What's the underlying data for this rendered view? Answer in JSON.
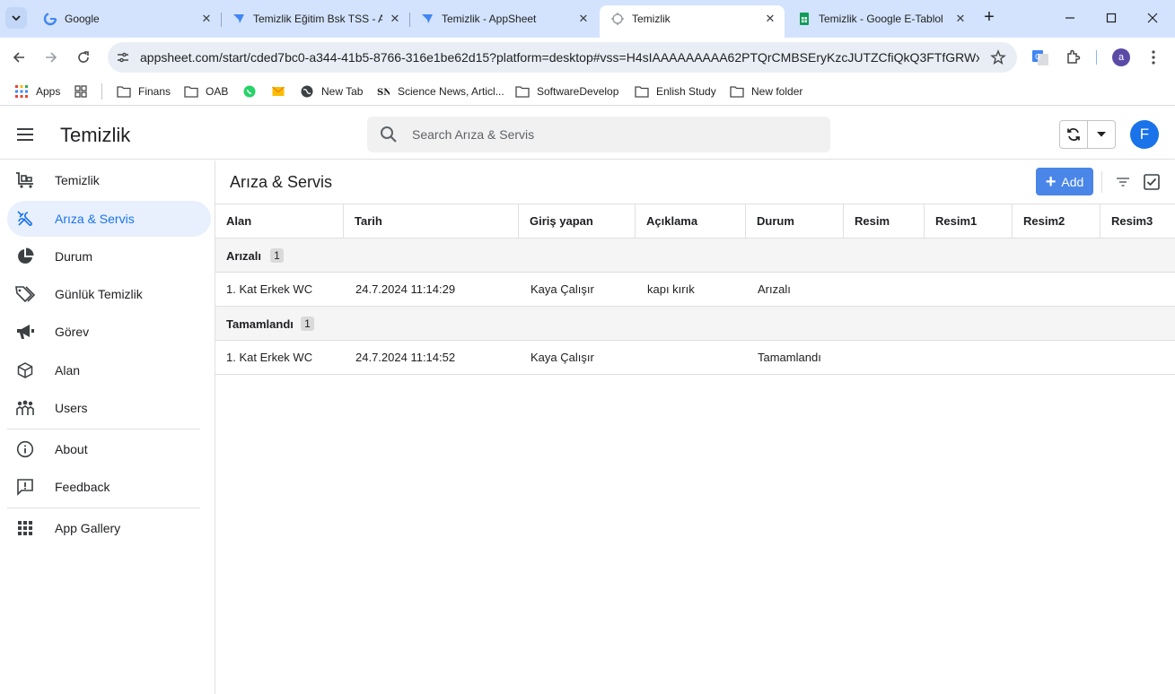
{
  "browser": {
    "tabs": [
      {
        "title": "Google",
        "favicon": "google-icon",
        "active": false
      },
      {
        "title": "Temizlik Eğitim Bsk TSS - A",
        "favicon": "appsheet-icon",
        "active": false
      },
      {
        "title": "Temizlik - AppSheet",
        "favicon": "appsheet-icon",
        "active": false
      },
      {
        "title": "Temizlik",
        "favicon": "loading-icon",
        "active": true
      },
      {
        "title": "Temizlik - Google E-Tablol",
        "favicon": "sheets-icon",
        "active": false
      }
    ],
    "url": "appsheet.com/start/cded7bc0-a344-41b5-8766-316e1be62d15?platform=desktop#vss=H4sIAAAAAAAAA62PTQrCMBSEryKzcJUTZCfiQkQ3FTfGRWxe...",
    "profile_initial": "a",
    "bookmarks": [
      {
        "label": "Apps",
        "icon": "apps-grid-icon"
      },
      {
        "label": "",
        "icon": "dashboard-icon"
      },
      {
        "label": "Finans",
        "icon": "folder-icon"
      },
      {
        "label": "OAB",
        "icon": "folder-icon"
      },
      {
        "label": "",
        "icon": "whatsapp-icon"
      },
      {
        "label": "",
        "icon": "mail-icon"
      },
      {
        "label": "New Tab",
        "icon": "globe-icon"
      },
      {
        "label": "Science News, Articl...",
        "icon": "sciencenews-icon"
      },
      {
        "label": "SoftwareDevelop",
        "icon": "folder-icon"
      },
      {
        "label": "Enlish Study",
        "icon": "folder-icon"
      },
      {
        "label": "New folder",
        "icon": "folder-icon"
      }
    ]
  },
  "app": {
    "title": "Temizlik",
    "search_placeholder": "Search Arıza & Servis",
    "avatar_initial": "F",
    "accent": "#1a73e8",
    "nav": [
      {
        "label": "Temizlik",
        "icon": "cart-icon",
        "active": false
      },
      {
        "label": "Arıza & Servis",
        "icon": "tools-icon",
        "active": true
      },
      {
        "label": "Durum",
        "icon": "pie-chart-icon",
        "active": false
      },
      {
        "label": "Günlük Temizlik",
        "icon": "tags-icon",
        "active": false
      },
      {
        "label": "Görev",
        "icon": "megaphone-icon",
        "active": false
      },
      {
        "label": "Alan",
        "icon": "cube-icon",
        "active": false
      },
      {
        "label": "Users",
        "icon": "users-icon",
        "active": false
      }
    ],
    "nav_secondary": [
      {
        "label": "About",
        "icon": "info-icon"
      },
      {
        "label": "Feedback",
        "icon": "feedback-icon"
      }
    ],
    "nav_tertiary": [
      {
        "label": "App Gallery",
        "icon": "grid-icon"
      }
    ]
  },
  "view": {
    "title": "Arıza & Servis",
    "add_label": "Add",
    "columns": [
      "Alan",
      "Tarih",
      "Giriş yapan",
      "Açıklama",
      "Durum",
      "Resim",
      "Resim1",
      "Resim2",
      "Resim3"
    ],
    "groups": [
      {
        "label": "Arızalı",
        "count": "1",
        "rows": [
          [
            "1. Kat Erkek WC",
            "24.7.2024 11:14:29",
            "Kaya Çalışır",
            "kapı kırık",
            "Arızalı",
            "",
            "",
            "",
            ""
          ]
        ]
      },
      {
        "label": "Tamamlandı",
        "count": "1",
        "rows": [
          [
            "1. Kat Erkek WC",
            "24.7.2024 11:14:52",
            "Kaya Çalışır",
            "",
            "Tamamlandı",
            "",
            "",
            "",
            ""
          ]
        ]
      }
    ]
  }
}
